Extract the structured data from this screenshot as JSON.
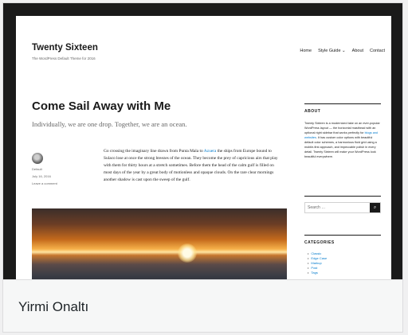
{
  "theme_name": "Yirmi Onaltı",
  "preview": {
    "site_title": "Twenty Sixteen",
    "site_description": "The WordPress Default Theme for 2016",
    "nav": [
      "Home",
      "Style Guide",
      "About",
      "Contact"
    ],
    "nav_dropdown_glyph": "⌄",
    "post": {
      "title": "Come Sail Away with Me",
      "excerpt": "Individually, we are one drop. Together, we are an ocean.",
      "author": "Default",
      "date": "July 16, 2016",
      "comments": "Leave a comment",
      "body_1": "Go crossing the imaginary line drawn from Punta Mala to",
      "body_link": "Azuera",
      "body_2": " the ships from Europe bound to Sulaco lose at once the strong breezes of the ocean. They become the prey of capricious airs that play with them for thirty hours at a stretch sometimes. Before them the head of the calm gulf is filled on most days of the year by a great body of motionless and opaque clouds. On the rare clear mornings another shadow is cast upon the sweep of the gulf."
    },
    "sidebar": {
      "about_title": "ABOUT",
      "about_1": "Twenty Sixteen is a modernized take on an ever-popular WordPress layout — the horizontal masthead with an optional right sidebar that works perfectly for",
      "about_link": "blogs and websites",
      "about_2": ". It has custom color options with beautiful default color schemes, a harmonious fluid grid using a mobile-first approach, and impeccable polish in every detail. Twenty Sixteen will make your WordPress look beautiful everywhere.",
      "search_placeholder": "Search …",
      "search_glyph": "⌕",
      "categories_title": "CATEGORIES",
      "categories": [
        "Classic",
        "Edge Case",
        "Markup",
        "Post",
        "Tags"
      ]
    }
  }
}
